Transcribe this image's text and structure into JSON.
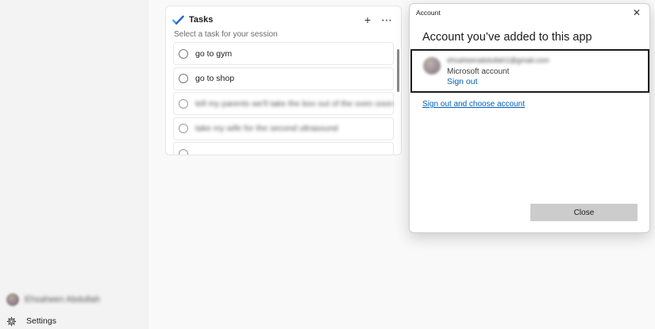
{
  "sidebar": {
    "profile_name": "Ehsaheen Abdullah",
    "settings_label": "Settings"
  },
  "tasks": {
    "title": "Tasks",
    "add_label": "+",
    "more_label": "⋯",
    "subtitle": "Select a task for your session",
    "items": [
      {
        "label": "go to gym"
      },
      {
        "label": "go to shop"
      },
      {
        "label": "tell my parents we'll take the box out of the oven soon"
      },
      {
        "label": "take my wife for the second ultrasound"
      },
      {
        "label": ""
      }
    ]
  },
  "dialog": {
    "window_title": "Account",
    "close_glyph": "✕",
    "heading": "Account you’ve added to this app",
    "account": {
      "email": "ehsaheenabdullah1@gmail.com",
      "type": "Microsoft account",
      "sign_out": "Sign out"
    },
    "switch_link": "Sign out and choose account",
    "close_button": "Close"
  },
  "colors": {
    "accent_link": "#005fb8",
    "tasks_check_blue": "#2564cf",
    "close_button_bg": "#cccccc"
  }
}
